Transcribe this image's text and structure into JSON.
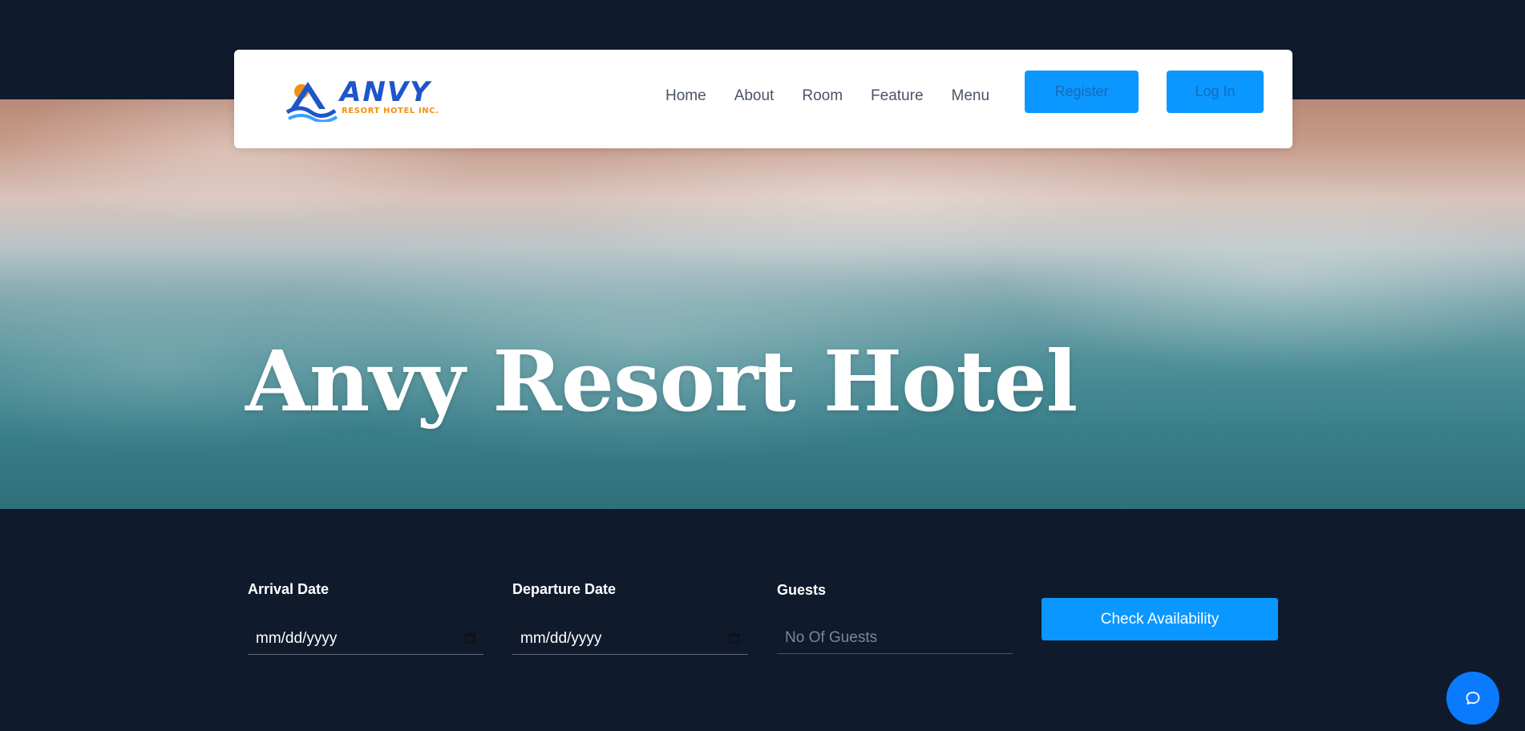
{
  "brand": {
    "logo_word": "ANVY",
    "logo_sub": "RESORT HOTEL INC."
  },
  "nav": {
    "items": [
      {
        "label": "Home"
      },
      {
        "label": "About"
      },
      {
        "label": "Room"
      },
      {
        "label": "Feature"
      },
      {
        "label": "Menu"
      }
    ],
    "register_label": "Register",
    "login_label": "Log In"
  },
  "hero": {
    "title": "Anvy Resort Hotel"
  },
  "booking": {
    "arrival_label": "Arrival Date",
    "arrival_value": "mm/dd/yyyy",
    "departure_label": "Departure Date",
    "departure_value": "mm/dd/yyyy",
    "guests_label": "Guests",
    "guests_placeholder": "No Of Guests",
    "check_label": "Check Availability"
  },
  "colors": {
    "page_bg": "#0f1a2d",
    "accent": "#0a97ff",
    "logo_blue": "#1e56c9",
    "logo_orange": "#f29111"
  },
  "icons": {
    "calendar": "calendar-icon",
    "chat": "chat-bubble-icon"
  }
}
